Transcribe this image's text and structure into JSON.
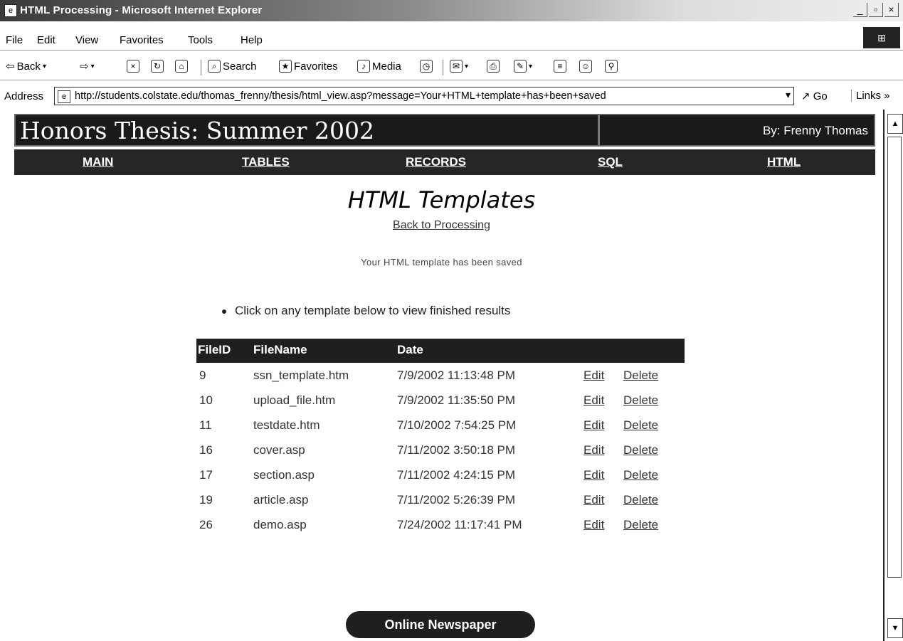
{
  "window": {
    "title": "HTML Processing - Microsoft Internet Explorer",
    "minimize": "_",
    "maximize": "▫",
    "close": "×"
  },
  "menu": [
    "File",
    "Edit",
    "View",
    "Favorites",
    "Tools",
    "Help"
  ],
  "toolbar": {
    "back": "Back",
    "search": "Search",
    "favorites": "Favorites",
    "media": "Media"
  },
  "address": {
    "label": "Address",
    "url": "http://students.colstate.edu/thomas_frenny/thesis/html_view.asp?message=Your+HTML+template+has+been+saved",
    "go": "Go",
    "links": "Links »"
  },
  "site": {
    "title": "Honors Thesis: Summer 2002",
    "author": "By: Frenny Thomas"
  },
  "nav": [
    "MAIN",
    "TABLES",
    "RECORDS",
    "SQL",
    "HTML"
  ],
  "main": {
    "heading": "HTML Templates",
    "back_link": "Back to Processing",
    "message": "Your HTML template has been saved",
    "instruction": "Click on any template below to view finished results"
  },
  "table": {
    "headers": {
      "id": "FileID",
      "name": "FileName",
      "date": "Date"
    },
    "rows": [
      {
        "id": "9",
        "name": "ssn_template.htm",
        "date": "7/9/2002 11:13:48 PM",
        "edit": "Edit",
        "delete": "Delete"
      },
      {
        "id": "10",
        "name": "upload_file.htm",
        "date": "7/9/2002 11:35:50 PM",
        "edit": "Edit",
        "delete": "Delete"
      },
      {
        "id": "11",
        "name": "testdate.htm",
        "date": "7/10/2002 7:54:25 PM",
        "edit": "Edit",
        "delete": "Delete"
      },
      {
        "id": "16",
        "name": "cover.asp",
        "date": "7/11/2002 3:50:18 PM",
        "edit": "Edit",
        "delete": "Delete"
      },
      {
        "id": "17",
        "name": "section.asp",
        "date": "7/11/2002 4:24:15 PM",
        "edit": "Edit",
        "delete": "Delete"
      },
      {
        "id": "19",
        "name": "article.asp",
        "date": "7/11/2002 5:26:39 PM",
        "edit": "Edit",
        "delete": "Delete"
      },
      {
        "id": "26",
        "name": "demo.asp",
        "date": "7/24/2002 11:17:41 PM",
        "edit": "Edit",
        "delete": "Delete"
      }
    ]
  },
  "footer_button": "Online Newspaper",
  "icons": [
    "ie-icon",
    "back-arrow-icon",
    "forward-arrow-icon",
    "stop-icon",
    "refresh-icon",
    "home-icon",
    "search-icon",
    "favorites-icon",
    "media-icon",
    "history-icon",
    "mail-icon",
    "print-icon",
    "edit-icon",
    "discuss-icon",
    "messenger-icon",
    "research-icon"
  ]
}
